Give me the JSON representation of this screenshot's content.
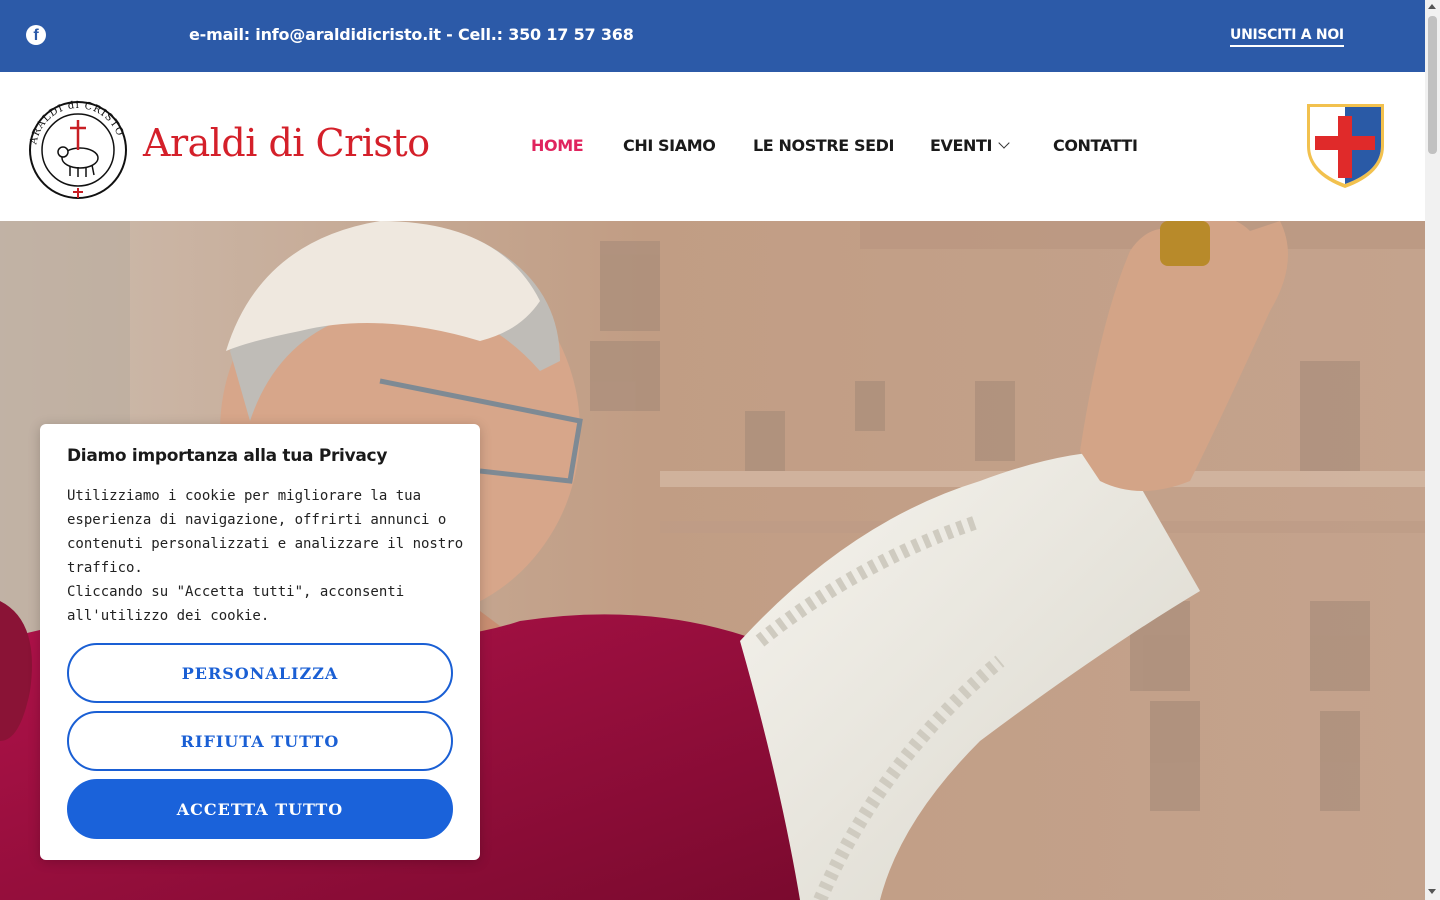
{
  "topbar": {
    "contact": "e-mail: info@araldidicristo.it - Cell.: 350 17 57 368",
    "join_label": "UNISCITI A NOI",
    "facebook_glyph": "f"
  },
  "header": {
    "site_name": "Araldi di Cristo",
    "seal_text": "ARALDI di CRISTO",
    "nav": [
      {
        "label": "HOME",
        "active": true
      },
      {
        "label": "CHI SIAMO"
      },
      {
        "label": "LE NOSTRE SEDI"
      },
      {
        "label": "EVENTI",
        "has_dropdown": true
      },
      {
        "label": "CONTATTI"
      }
    ]
  },
  "cookie_banner": {
    "title": "Diamo importanza alla tua Privacy",
    "paragraph1": "Utilizziamo i cookie per migliorare la tua esperienza di navigazione, offrirti annunci o contenuti personalizzati e analizzare il nostro traffico.",
    "paragraph2": "Cliccando su \"Accetta tutti\", acconsenti all'utilizzo dei cookie.",
    "customize_label": "PERSONALIZZA",
    "reject_label": "RIFIUTA TUTTO",
    "accept_label": "ACCETTA TUTTO"
  },
  "colors": {
    "topbar": "#2c5aa8",
    "nav_active": "#e0245e",
    "logo_red": "#d4202a",
    "button_blue": "#1a62da"
  }
}
